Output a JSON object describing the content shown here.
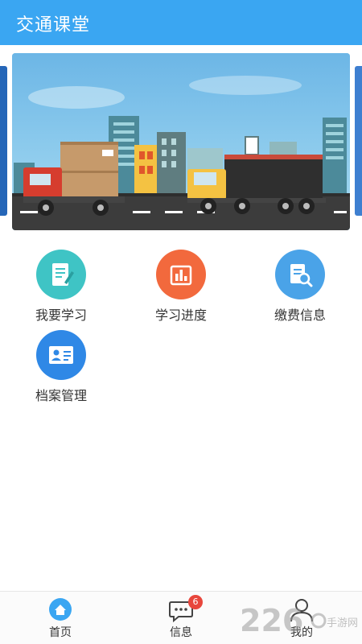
{
  "header": {
    "title": "交通课堂"
  },
  "banner": {
    "description": ""
  },
  "menu": {
    "items": [
      {
        "label": "我要学习",
        "icon": "notebook-pen-icon",
        "color": "#3fc4c5"
      },
      {
        "label": "学习进度",
        "icon": "bar-chart-icon",
        "color": "#f2693d"
      },
      {
        "label": "缴费信息",
        "icon": "card-search-icon",
        "color": "#4aa3e8"
      },
      {
        "label": "档案管理",
        "icon": "id-card-icon",
        "color": "#2f88e6"
      }
    ]
  },
  "tabbar": {
    "tabs": [
      {
        "label": "首页",
        "icon": "home-icon",
        "active": true
      },
      {
        "label": "信息",
        "icon": "chat-bubble-icon",
        "badge": "6"
      },
      {
        "label": "我的",
        "icon": "user-icon"
      }
    ]
  },
  "watermark": {
    "number": "226",
    "text": "手游网"
  },
  "colors": {
    "primary": "#3aa6f2",
    "badge": "#e8463c"
  }
}
